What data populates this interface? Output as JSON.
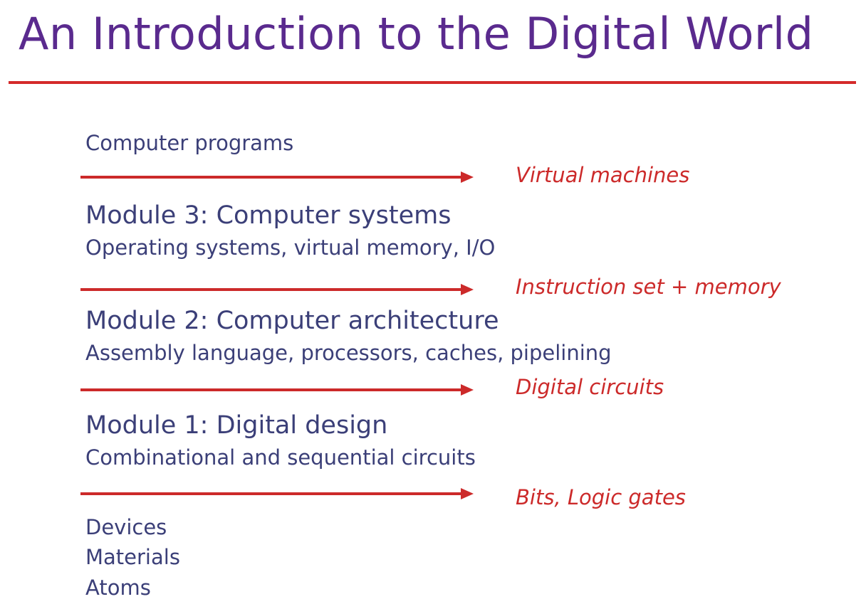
{
  "title": "An Introduction to the Digital World",
  "top_item": "Computer programs",
  "interfaces": [
    "Virtual machines",
    "Instruction set + memory",
    "Digital circuits",
    "Bits, Logic gates"
  ],
  "modules": [
    {
      "heading": "Module 3: Computer systems",
      "topics": "Operating systems, virtual memory, I/O"
    },
    {
      "heading": "Module 2: Computer architecture",
      "topics": "Assembly language, processors, caches, pipelining"
    },
    {
      "heading": "Module 1: Digital design",
      "topics": "Combinational and sequential circuits"
    }
  ],
  "bottom_items": [
    "Devices",
    "Materials",
    "Atoms"
  ],
  "colors": {
    "title": "#5a2a8e",
    "body_text": "#3b3f78",
    "accent_red": "#cc2a2a"
  }
}
